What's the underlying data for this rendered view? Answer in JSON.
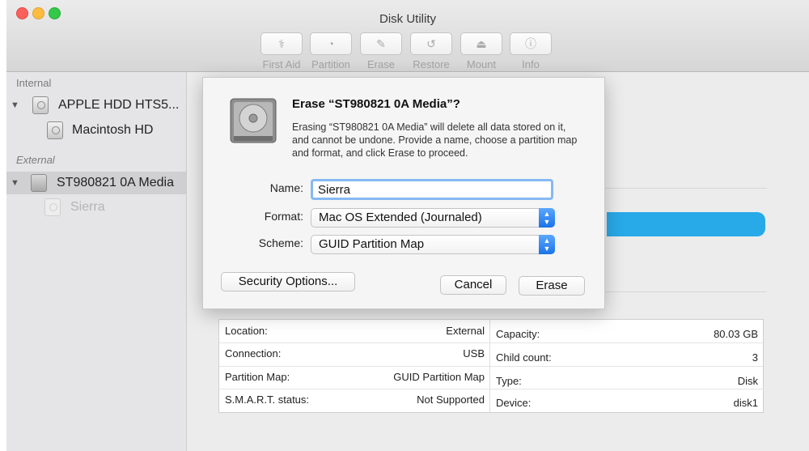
{
  "window": {
    "title": "Disk Utility"
  },
  "toolbar": {
    "items": [
      {
        "label": "First Aid",
        "icon": "stethoscope-icon",
        "glyph": "⚕"
      },
      {
        "label": "Partition",
        "icon": "pie-chart-icon",
        "glyph": "◔"
      },
      {
        "label": "Erase",
        "icon": "eraser-icon",
        "glyph": "✎"
      },
      {
        "label": "Restore",
        "icon": "restore-icon",
        "glyph": "↺"
      },
      {
        "label": "Mount",
        "icon": "mount-icon",
        "glyph": "⏏"
      },
      {
        "label": "Info",
        "icon": "info-icon",
        "glyph": "ⓘ"
      }
    ]
  },
  "sidebar": {
    "internal_label": "Internal",
    "external_label": "External",
    "items": [
      {
        "label": "APPLE HDD HTS5...",
        "kind": "disk"
      },
      {
        "label": "Macintosh HD",
        "kind": "volume"
      },
      {
        "label": "ST980821 0A Media",
        "kind": "disk",
        "selected": true
      },
      {
        "label": "Sierra",
        "kind": "volume",
        "dimmed": true
      }
    ]
  },
  "dialog": {
    "title": "Erase “ST980821 0A Media”?",
    "message": "Erasing “ST980821 0A Media” will delete all data stored on it, and cannot be undone. Provide a name, choose a partition map and format, and click Erase to proceed.",
    "name_label": "Name:",
    "name_value": "Sierra",
    "format_label": "Format:",
    "format_value": "Mac OS Extended (Journaled)",
    "scheme_label": "Scheme:",
    "scheme_value": "GUID Partition Map",
    "security_button": "Security Options...",
    "cancel_button": "Cancel",
    "erase_button": "Erase"
  },
  "info": {
    "left": [
      {
        "key": "Location:",
        "value": "External"
      },
      {
        "key": "Connection:",
        "value": "USB"
      },
      {
        "key": "Partition Map:",
        "value": "GUID Partition Map"
      },
      {
        "key": "S.M.A.R.T. status:",
        "value": "Not Supported"
      }
    ],
    "right": [
      {
        "key": "Capacity:",
        "value": "80.03 GB"
      },
      {
        "key": "Child count:",
        "value": "3"
      },
      {
        "key": "Type:",
        "value": "Disk"
      },
      {
        "key": "Device:",
        "value": "disk1"
      }
    ]
  },
  "colors": {
    "accent": "#1a73e8",
    "usage_bar": "#28a9e8",
    "focus_ring": "#86b8f3"
  }
}
